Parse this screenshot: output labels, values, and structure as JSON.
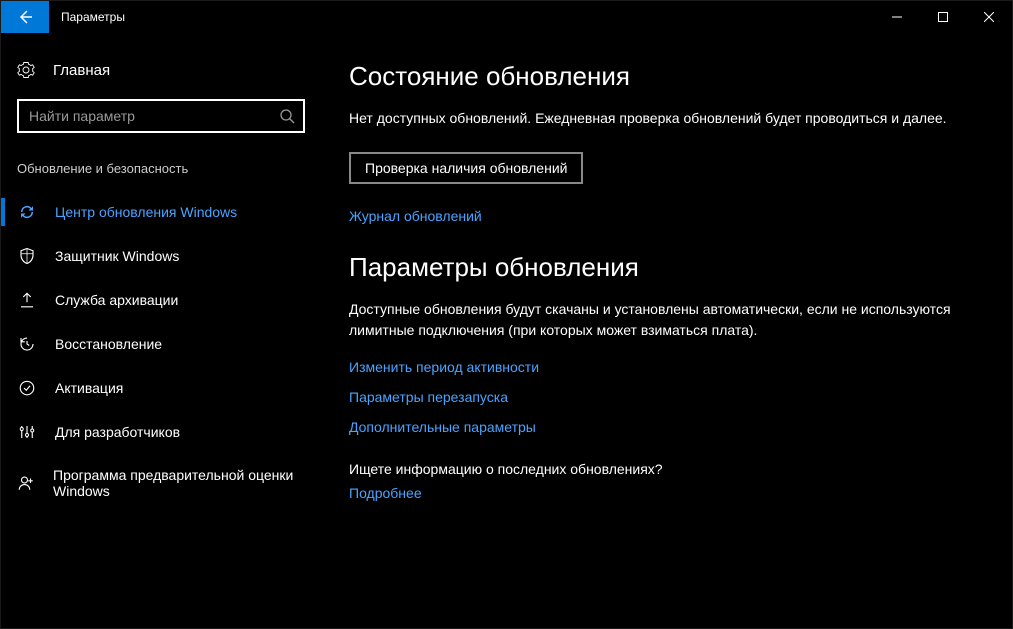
{
  "window": {
    "title": "Параметры"
  },
  "sidebar": {
    "home": "Главная",
    "search_placeholder": "Найти параметр",
    "section_header": "Обновление и безопасность",
    "items": [
      {
        "label": "Центр обновления Windows",
        "active": true
      },
      {
        "label": "Защитник Windows",
        "active": false
      },
      {
        "label": "Служба архивации",
        "active": false
      },
      {
        "label": "Восстановление",
        "active": false
      },
      {
        "label": "Активация",
        "active": false
      },
      {
        "label": "Для разработчиков",
        "active": false
      },
      {
        "label": "Программа предварительной оценки Windows",
        "active": false
      }
    ]
  },
  "main": {
    "status_heading": "Состояние обновления",
    "status_text": "Нет доступных обновлений. Ежедневная проверка обновлений будет проводиться и далее.",
    "check_button": "Проверка наличия обновлений",
    "history_link": "Журнал обновлений",
    "settings_heading": "Параметры обновления",
    "settings_desc": "Доступные обновления будут скачаны и установлены автоматически, если не используются лимитные подключения (при которых может взиматься плата).",
    "link_active_hours": "Изменить период активности",
    "link_restart": "Параметры перезапуска",
    "link_advanced": "Дополнительные параметры",
    "info_question": "Ищете информацию о последних обновлениях?",
    "learn_more": "Подробнее"
  }
}
